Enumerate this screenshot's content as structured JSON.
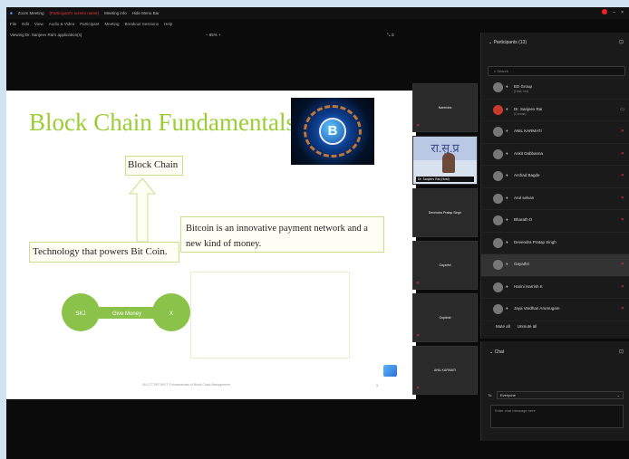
{
  "window": {
    "title": "Zoom Meeting",
    "recording_text": "(Participant's screen name)",
    "meeting_info": "Meeting info",
    "view": "Hide Menu Bar"
  },
  "menu": [
    "File",
    "Edit",
    "View",
    "Audio & Video",
    "Participant",
    "Meeting",
    "Breakout Sessions",
    "Help"
  ],
  "viewbar": {
    "viewing": "Viewing Dr. Sanjeev Rai's application(s)",
    "zoom": "65%"
  },
  "slide": {
    "title": "Block Chain Fundamentals",
    "block_chain_label": "Block Chain",
    "technology_label": "Technology that powers Bit Coin.",
    "bitcoin_text": "Bitcoin is an innovative payment network and a new kind of money.",
    "flow_left": "SKJ",
    "flow_middle": "Give Money",
    "flow_right": "X",
    "footer": "SKJ CT DET/KR T Fundamentals of Block Chain Management",
    "page": "5",
    "image_coin_letter": "B"
  },
  "thumbnails": [
    {
      "name": "Narendra"
    },
    {
      "name": "Dr. Sanjeev Rai (Host)",
      "video_text": "रा.सु.प्र"
    },
    {
      "name": "Devendra Pratap Singh"
    },
    {
      "name": "Gayathri"
    },
    {
      "name": "Gopikrid"
    },
    {
      "name": "ANIL KARMATI"
    }
  ],
  "participants": {
    "header": "Participants (13)",
    "search_placeholder": "Search",
    "list": [
      {
        "name": "ED Group",
        "sub": "(Host, me)"
      },
      {
        "name": "Dr. Sanjeev Rai",
        "sub": "(Cohost)"
      },
      {
        "name": "ANIL KARMATI",
        "sub": ""
      },
      {
        "name": "Ankit Dabbanna",
        "sub": ""
      },
      {
        "name": "Arshad Bagde",
        "sub": ""
      },
      {
        "name": "Arul selvan",
        "sub": ""
      },
      {
        "name": "Bharath D",
        "sub": ""
      },
      {
        "name": "Devendra Pratap Singh",
        "sub": ""
      },
      {
        "name": "Gayathri",
        "sub": ""
      },
      {
        "name": "Harini Harrish K",
        "sub": ""
      },
      {
        "name": "Jaya Vardhan Arumugam",
        "sub": ""
      }
    ],
    "mute_all": "Mute all",
    "unmute_all": "Unmute all"
  },
  "chat": {
    "header": "Chat",
    "to_label": "To:",
    "to_value": "Everyone",
    "input_placeholder": "Enter chat message here"
  },
  "colors": {
    "slide_title": "#9acd32",
    "flow_green": "#8bc34a",
    "mic_muted": "#e33333"
  }
}
